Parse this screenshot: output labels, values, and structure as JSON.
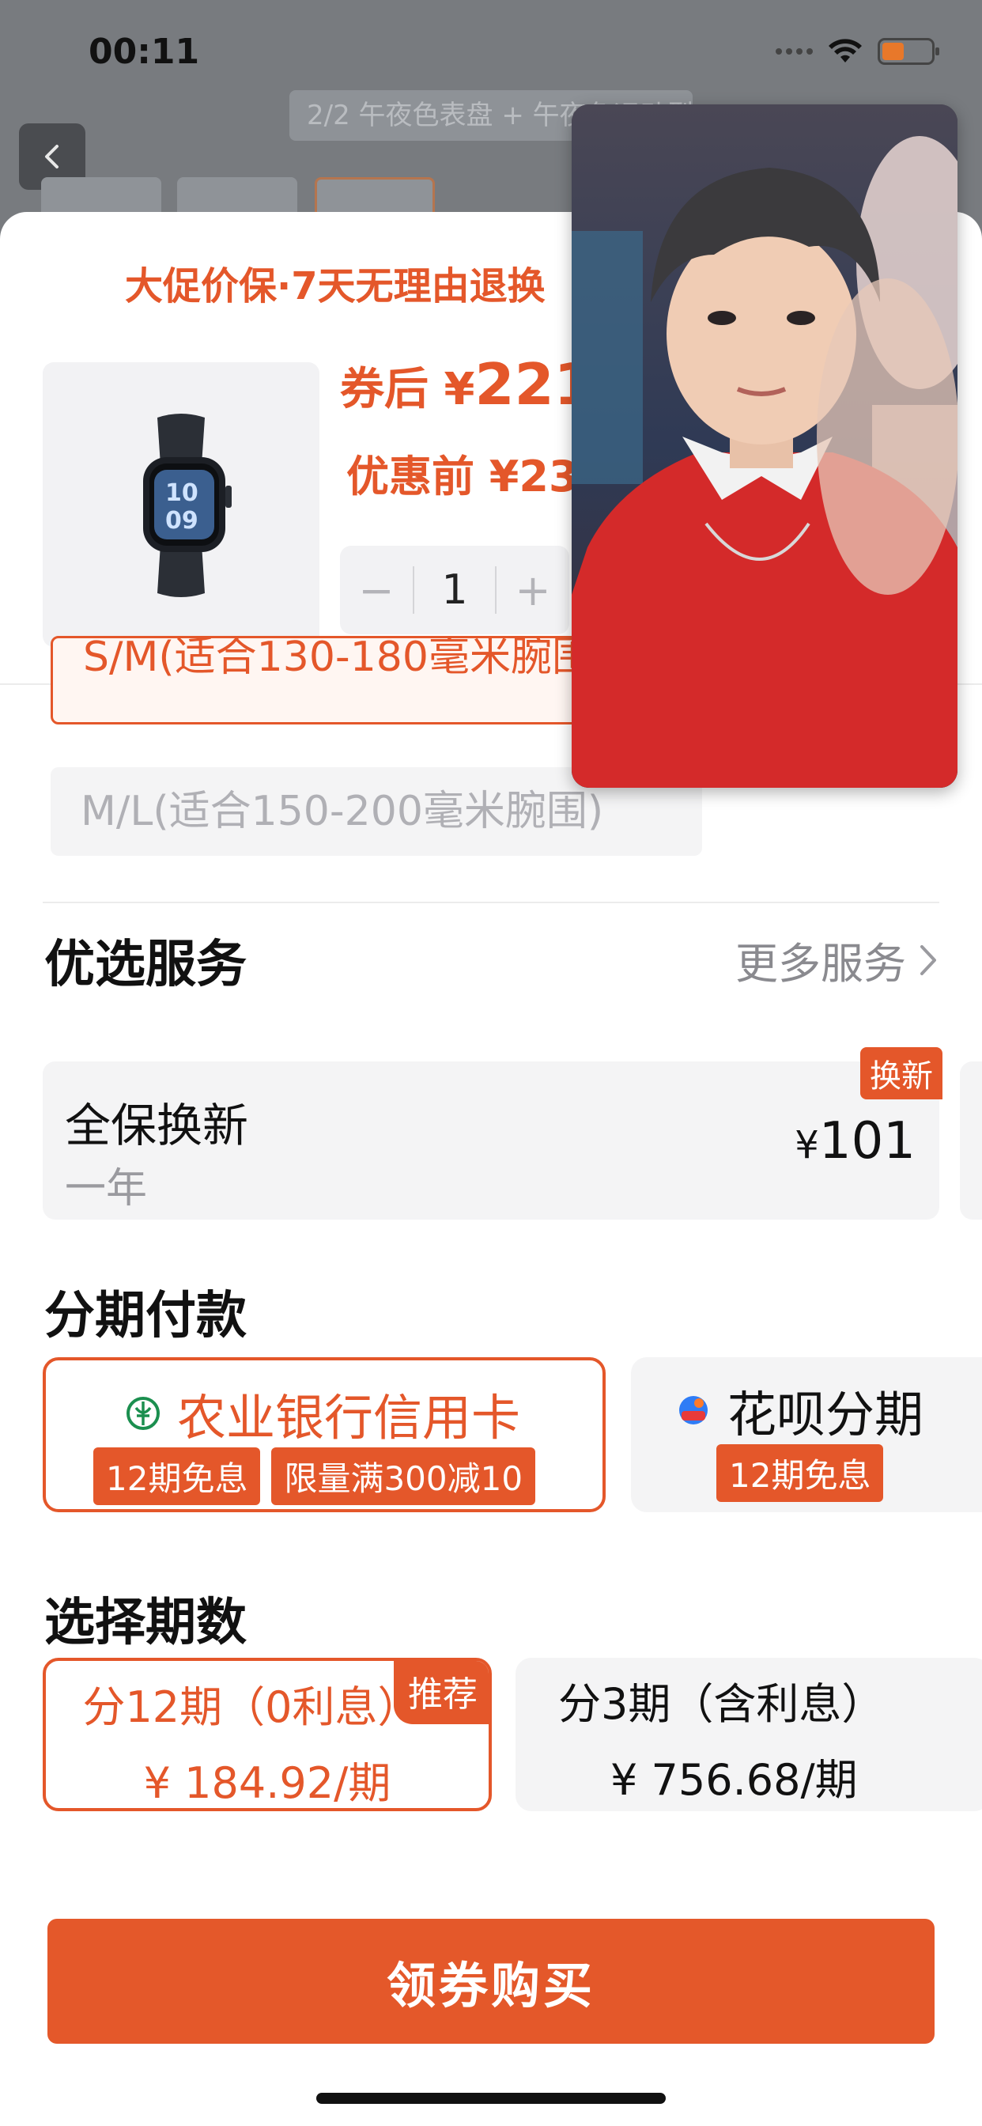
{
  "status_bar": {
    "time": "00:11"
  },
  "background_page": {
    "title": "2/2 午夜色表盘 + 午夜色运动型表带"
  },
  "product": {
    "promo_banner": "大促价保·7天无理由退换",
    "price_after_label": "券后 ¥",
    "price_after_value": "221",
    "price_before": "优惠前 ¥23",
    "quantity": "1",
    "minus": "−",
    "plus": "+"
  },
  "sizes": {
    "selected": "S/M(适合130-180毫米腕围)",
    "other": "M/L(适合150-200毫米腕围)"
  },
  "services": {
    "title": "优选服务",
    "more_label": "更多服务",
    "card": {
      "name": "全保换新",
      "sub": "一年",
      "currency": "¥",
      "price": "101",
      "tag": "换新"
    }
  },
  "installments": {
    "title": "分期付款",
    "options": [
      {
        "name": "农业银行信用卡",
        "tags": [
          "12期免息",
          "限量满300减10"
        ]
      },
      {
        "name": "花呗分期",
        "tags": [
          "12期免息"
        ]
      }
    ]
  },
  "periods": {
    "title": "选择期数",
    "options": [
      {
        "label": "分12期（0利息）",
        "price": "¥ 184.92/期",
        "badge": "推荐"
      },
      {
        "label": "分3期（含利息）",
        "price": "¥ 756.68/期"
      }
    ]
  },
  "buy_button": "领券购买",
  "colors": {
    "accent": "#e4572a",
    "card_bg": "#f4f4f5"
  }
}
